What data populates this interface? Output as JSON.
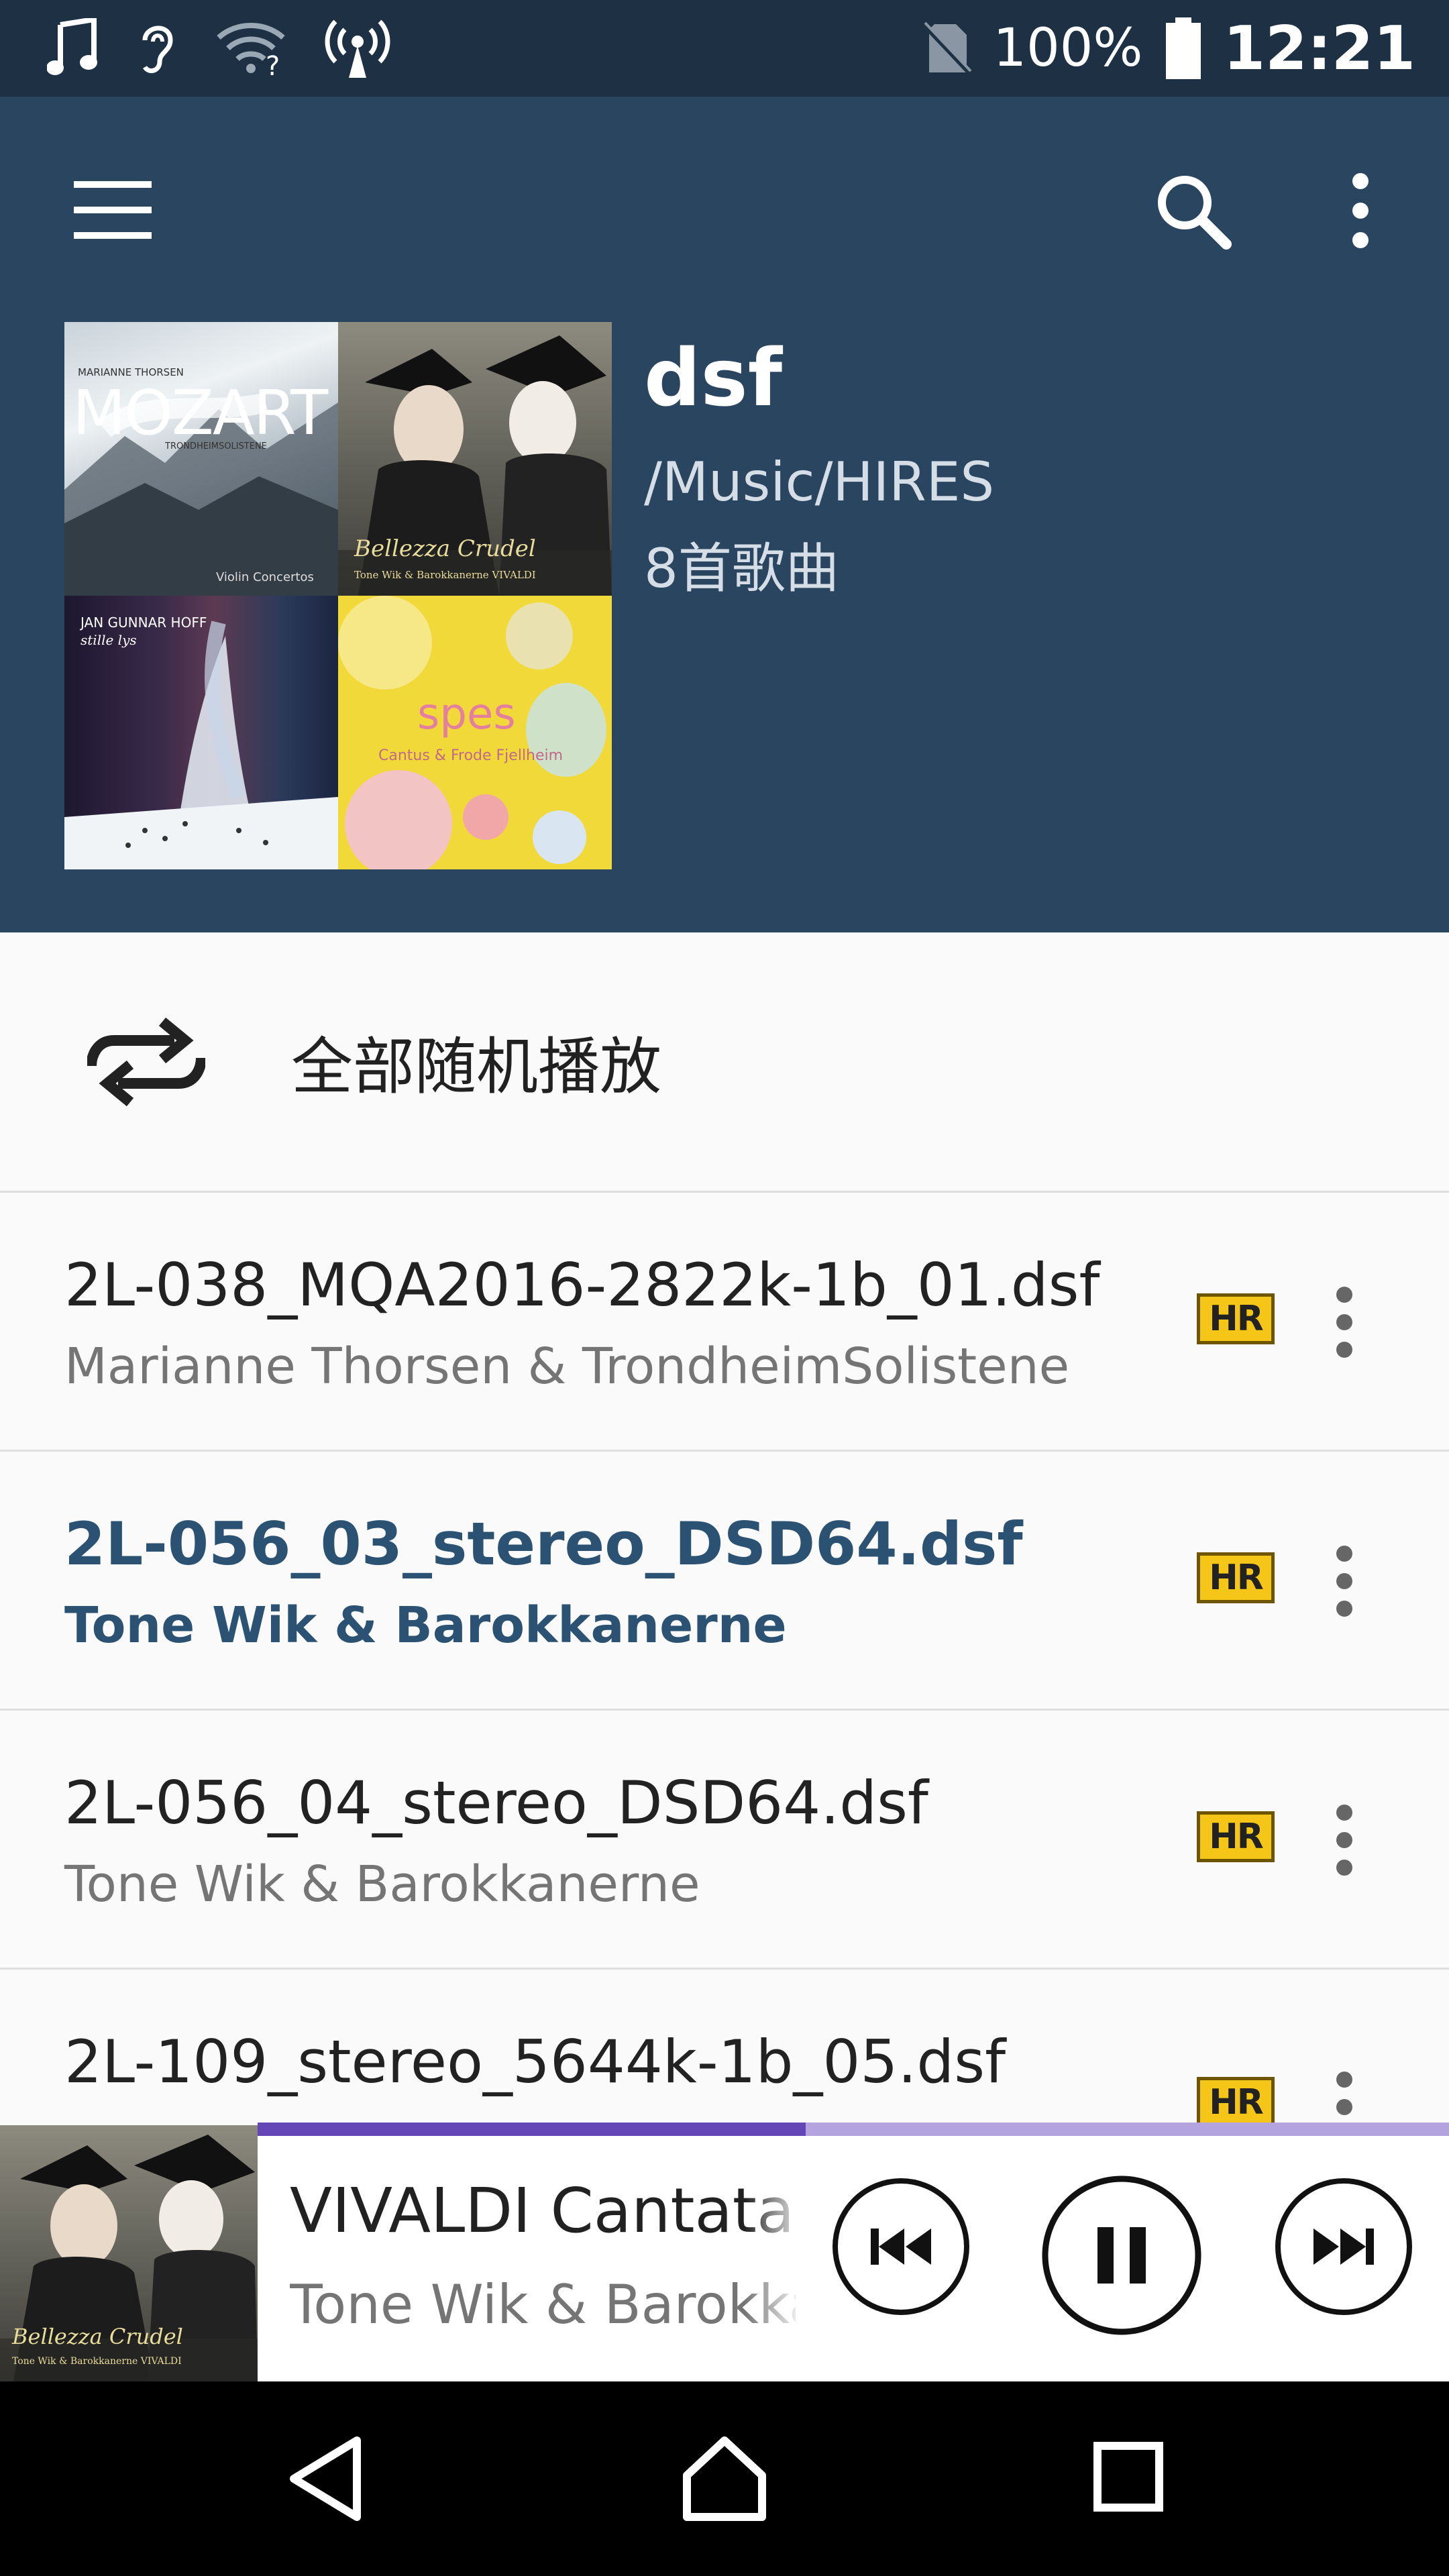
{
  "status_bar": {
    "icons": [
      "music-note-icon",
      "hearing-icon",
      "wifi-question-icon",
      "broadcast-icon",
      "no-sim-icon",
      "battery-icon"
    ],
    "battery": "100%",
    "time": "12:21"
  },
  "toolbar": {
    "icons": [
      "menu-icon",
      "search-icon",
      "more-vert-icon"
    ]
  },
  "playlist": {
    "title": "dsf",
    "path": "/Music/HIRES",
    "count": "8首歌曲",
    "covers": [
      {
        "name": "mozart-cover",
        "text_top": "MARIANNE THORSEN",
        "text_main": "MOZART",
        "text_sub": "TRONDHEIMSOLISTENE",
        "text_bottom": "Violin Concertos"
      },
      {
        "name": "bellezza-crudel-cover",
        "text_main": "Bellezza Crudel",
        "text_sub": "Tone Wik & Barokkanerne  VIVALDI"
      },
      {
        "name": "stille-lys-cover",
        "text_main": "JAN GUNNAR HOFF",
        "text_sub": "stille lys"
      },
      {
        "name": "spes-cover",
        "text_main": "spes",
        "text_sub": "Cantus & Frode Fjellheim"
      }
    ]
  },
  "shuffle": {
    "label": "全部随机播放"
  },
  "tracks": [
    {
      "title": "2L-038_MQA2016-2822k-1b_01.dsf",
      "artist": "Marianne Thorsen & TrondheimSolistene",
      "badge": "HR",
      "active": false
    },
    {
      "title": "2L-056_03_stereo_DSD64.dsf",
      "artist": "Tone Wik & Barokkanerne",
      "badge": "HR",
      "active": true
    },
    {
      "title": "2L-056_04_stereo_DSD64.dsf",
      "artist": "Tone Wik & Barokkanerne",
      "badge": "HR",
      "active": false
    },
    {
      "title": "2L-109_stereo_5644k-1b_05.dsf",
      "artist": "",
      "badge": "HR",
      "active": false
    }
  ],
  "now_playing": {
    "title": "VIVALDI Cantata I",
    "artist": "Tone Wik & Barokkanerne",
    "progress": 0.46,
    "cover": {
      "text_main": "Bellezza Crudel",
      "text_sub": "Tone Wik & Barokkanerne  VIVALDI"
    },
    "controls": [
      "previous-icon",
      "pause-icon",
      "next-icon"
    ]
  },
  "navigation": [
    "back-icon",
    "home-icon",
    "recents-icon"
  ],
  "colors": {
    "status_bar": "#1e3144",
    "header": "#294560",
    "active_track": "#2b5272",
    "progress_played": "#6446b6",
    "progress_remaining": "#b3a3de",
    "hr_badge": "#f5c518"
  }
}
